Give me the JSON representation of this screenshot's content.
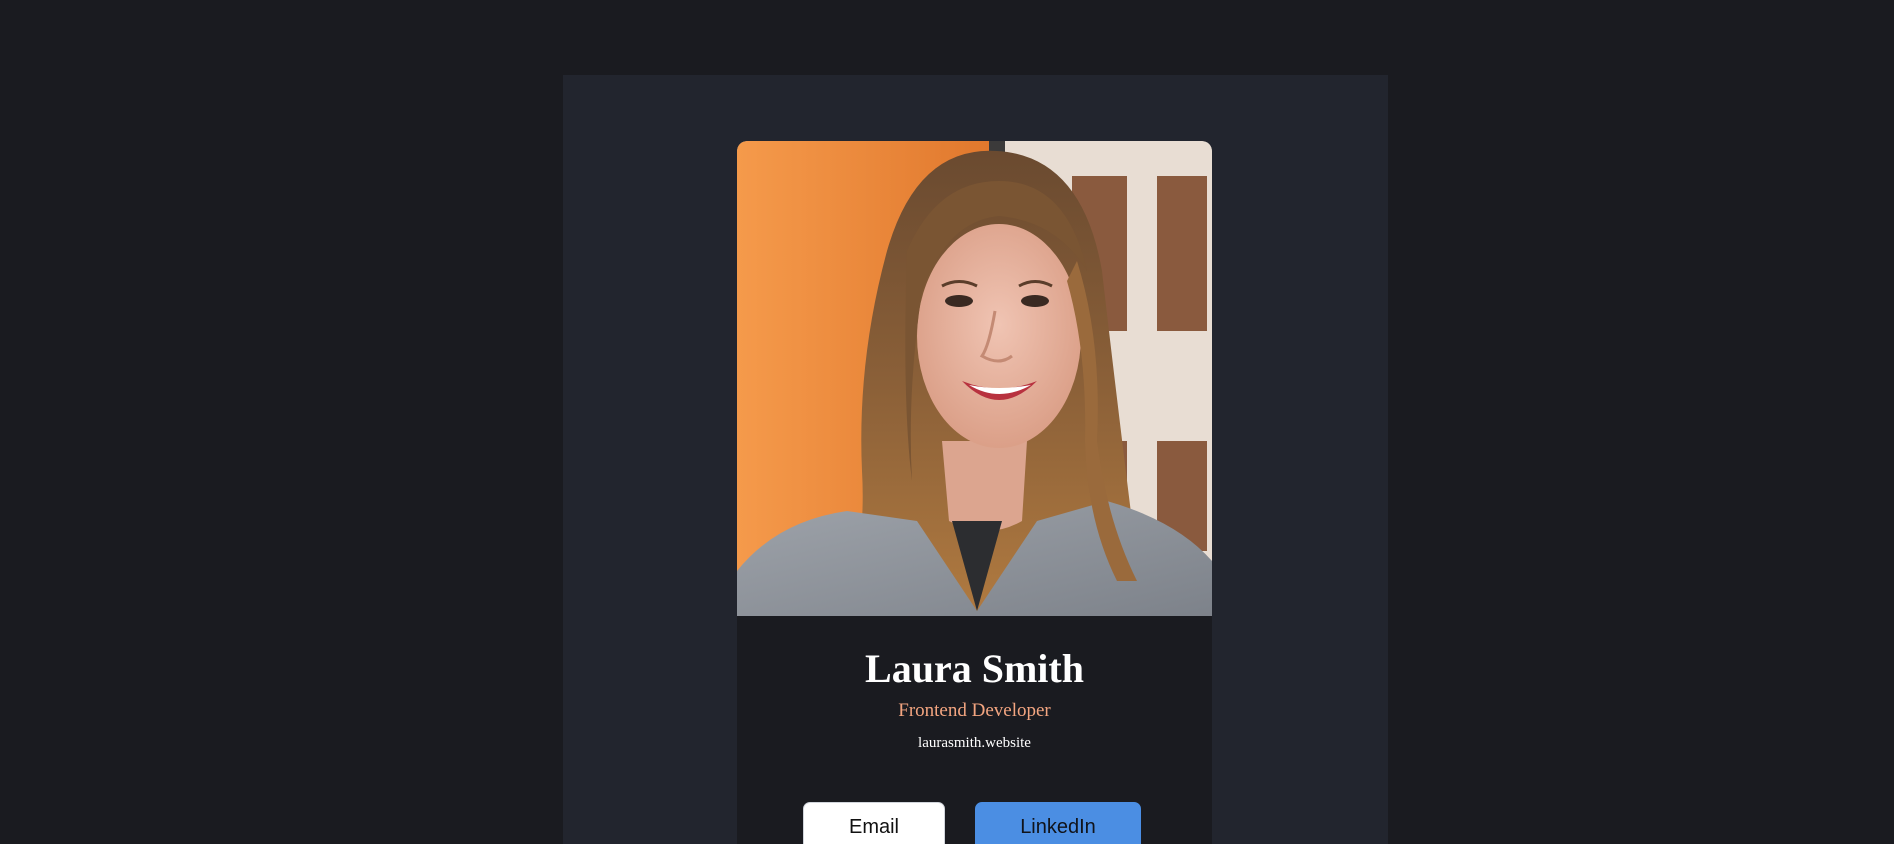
{
  "profile": {
    "name": "Laura Smith",
    "role": "Frontend Developer",
    "website": "laurasmith.website",
    "photo_alt": "Laura Smith"
  },
  "actions": {
    "email_label": "Email",
    "linkedin_label": "LinkedIn"
  },
  "colors": {
    "background": "#1a1b20",
    "panel": "#22252e",
    "card": "#1a1b20",
    "role_accent": "#f3a580",
    "linkedin_button": "#4b8ee3",
    "email_button": "#ffffff"
  }
}
